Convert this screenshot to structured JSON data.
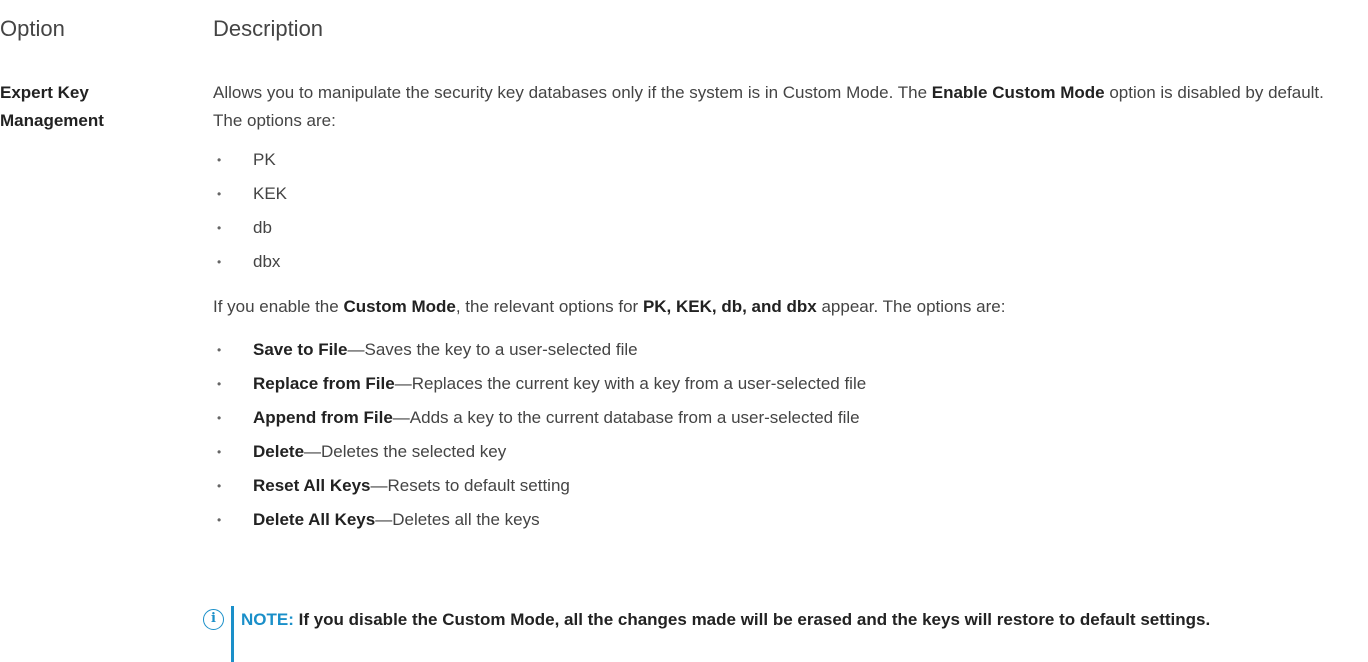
{
  "header": {
    "option": "Option",
    "description": "Description"
  },
  "option_name": "Expert Key Management",
  "intro": {
    "part1": "Allows you to manipulate the security key databases only if the system is in Custom Mode. The ",
    "bold1": "Enable Custom Mode",
    "part2": " option is disabled by default. The options are:"
  },
  "key_db_list": [
    "PK",
    "KEK",
    "db",
    "dbx"
  ],
  "para2": {
    "part1": "If you enable the ",
    "bold1": "Custom Mode",
    "part2": ", the relevant options for ",
    "bold2": "PK, KEK, db, and dbx",
    "part3": " appear. The options are:"
  },
  "custom_options": [
    {
      "term": "Save to File",
      "desc": "—Saves the key to a user-selected file"
    },
    {
      "term": "Replace from File",
      "desc": "—Replaces the current key with a key from a user-selected file"
    },
    {
      "term": "Append from File",
      "desc": "—Adds a key to the current database from a user-selected file"
    },
    {
      "term": "Delete",
      "desc": "—Deletes the selected key"
    },
    {
      "term": "Reset All Keys",
      "desc": "—Resets to default setting"
    },
    {
      "term": "Delete All Keys",
      "desc": "—Deletes all the keys"
    }
  ],
  "note": {
    "icon": "info-icon",
    "label": "NOTE:",
    "text": " If you disable the Custom Mode, all the changes made will be erased and the keys will restore to default settings."
  },
  "colors": {
    "accent": "#1a8fc9",
    "text": "#444444",
    "bold_text": "#222222"
  }
}
